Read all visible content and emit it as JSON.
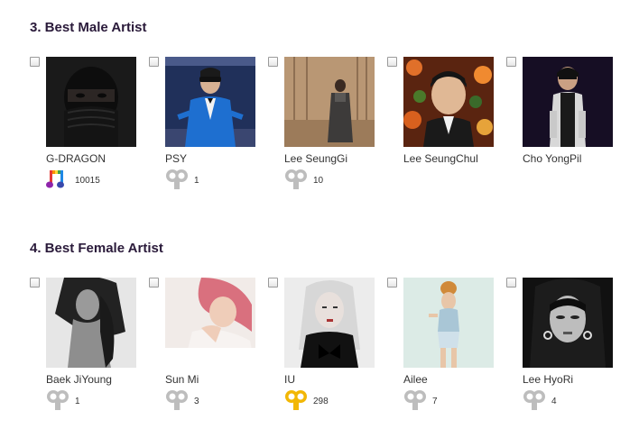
{
  "sections": [
    {
      "title": "3. Best Male Artist",
      "nominees": [
        {
          "name": "G-DRAGON",
          "votes": "10015",
          "icon": "rainbow-music-note-icon"
        },
        {
          "name": "PSY",
          "votes": "1",
          "icon": "gray-vote-icon"
        },
        {
          "name": "Lee SeungGi",
          "votes": "10",
          "icon": "gray-vote-icon"
        },
        {
          "name": "Lee SeungChul",
          "votes": "",
          "icon": ""
        },
        {
          "name": "Cho YongPil",
          "votes": "",
          "icon": ""
        }
      ]
    },
    {
      "title": "4. Best Female Artist",
      "nominees": [
        {
          "name": "Baek JiYoung",
          "votes": "1",
          "icon": "gray-vote-icon"
        },
        {
          "name": "Sun Mi",
          "votes": "3",
          "icon": "gray-vote-icon"
        },
        {
          "name": "IU",
          "votes": "298",
          "icon": "gold-vote-icon"
        },
        {
          "name": "Ailee",
          "votes": "7",
          "icon": "gray-vote-icon"
        },
        {
          "name": "Lee HyoRi",
          "votes": "4",
          "icon": "gray-vote-icon"
        }
      ]
    }
  ],
  "colors": {
    "title": "#2a1a3a",
    "vote_gray": "#bdbdbd",
    "vote_gold": "#f2b705"
  }
}
